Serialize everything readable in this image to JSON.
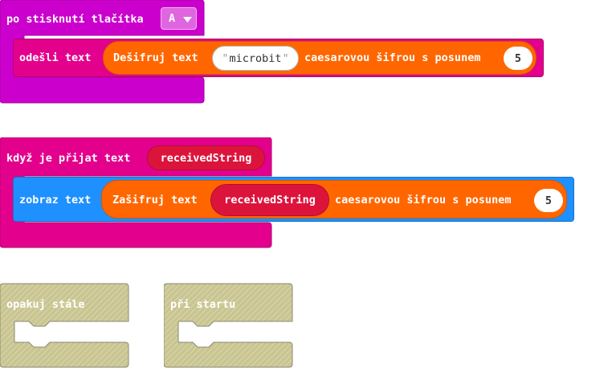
{
  "block1": {
    "event_label": "po stisknutí tlačítka",
    "button_value": "A",
    "send_label": "odešli text",
    "decrypt_label": "Dešifruj text",
    "string_value": "microbit",
    "cipher_label": "caesarovou šifrou s posunem",
    "shift_value": "5"
  },
  "block2": {
    "event_label": "když je přijat text",
    "param_label": "receivedString",
    "show_label": "zobraz text",
    "encrypt_label": "Zašifruj text",
    "var_label": "receivedString",
    "cipher_label": "caesarovou šifrou s posunem",
    "shift_value": "5"
  },
  "block3": {
    "label": "opakuj stále"
  },
  "block4": {
    "label": "při startu"
  },
  "colors": {
    "event": "#cc00cc",
    "radio": "#e3008c",
    "basic": "#1e90ff",
    "cipher": "#ff6600",
    "variable": "#dc143c",
    "disabled": "#c8c49a"
  }
}
